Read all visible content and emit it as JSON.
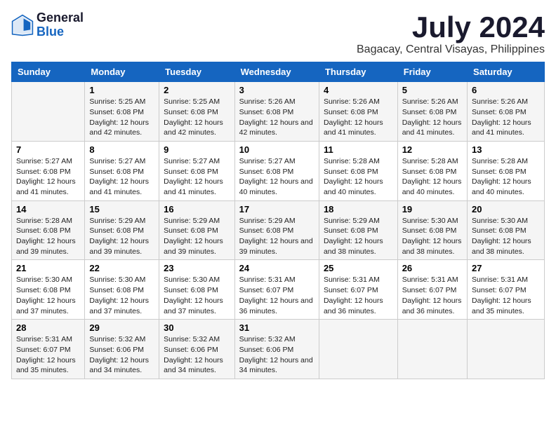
{
  "logo": {
    "general": "General",
    "blue": "Blue"
  },
  "title": "July 2024",
  "subtitle": "Bagacay, Central Visayas, Philippines",
  "days_header": [
    "Sunday",
    "Monday",
    "Tuesday",
    "Wednesday",
    "Thursday",
    "Friday",
    "Saturday"
  ],
  "weeks": [
    [
      {
        "day": "",
        "sunrise": "",
        "sunset": "",
        "daylight": ""
      },
      {
        "day": "1",
        "sunrise": "Sunrise: 5:25 AM",
        "sunset": "Sunset: 6:08 PM",
        "daylight": "Daylight: 12 hours and 42 minutes."
      },
      {
        "day": "2",
        "sunrise": "Sunrise: 5:25 AM",
        "sunset": "Sunset: 6:08 PM",
        "daylight": "Daylight: 12 hours and 42 minutes."
      },
      {
        "day": "3",
        "sunrise": "Sunrise: 5:26 AM",
        "sunset": "Sunset: 6:08 PM",
        "daylight": "Daylight: 12 hours and 42 minutes."
      },
      {
        "day": "4",
        "sunrise": "Sunrise: 5:26 AM",
        "sunset": "Sunset: 6:08 PM",
        "daylight": "Daylight: 12 hours and 41 minutes."
      },
      {
        "day": "5",
        "sunrise": "Sunrise: 5:26 AM",
        "sunset": "Sunset: 6:08 PM",
        "daylight": "Daylight: 12 hours and 41 minutes."
      },
      {
        "day": "6",
        "sunrise": "Sunrise: 5:26 AM",
        "sunset": "Sunset: 6:08 PM",
        "daylight": "Daylight: 12 hours and 41 minutes."
      }
    ],
    [
      {
        "day": "7",
        "sunrise": "Sunrise: 5:27 AM",
        "sunset": "Sunset: 6:08 PM",
        "daylight": "Daylight: 12 hours and 41 minutes."
      },
      {
        "day": "8",
        "sunrise": "Sunrise: 5:27 AM",
        "sunset": "Sunset: 6:08 PM",
        "daylight": "Daylight: 12 hours and 41 minutes."
      },
      {
        "day": "9",
        "sunrise": "Sunrise: 5:27 AM",
        "sunset": "Sunset: 6:08 PM",
        "daylight": "Daylight: 12 hours and 41 minutes."
      },
      {
        "day": "10",
        "sunrise": "Sunrise: 5:27 AM",
        "sunset": "Sunset: 6:08 PM",
        "daylight": "Daylight: 12 hours and 40 minutes."
      },
      {
        "day": "11",
        "sunrise": "Sunrise: 5:28 AM",
        "sunset": "Sunset: 6:08 PM",
        "daylight": "Daylight: 12 hours and 40 minutes."
      },
      {
        "day": "12",
        "sunrise": "Sunrise: 5:28 AM",
        "sunset": "Sunset: 6:08 PM",
        "daylight": "Daylight: 12 hours and 40 minutes."
      },
      {
        "day": "13",
        "sunrise": "Sunrise: 5:28 AM",
        "sunset": "Sunset: 6:08 PM",
        "daylight": "Daylight: 12 hours and 40 minutes."
      }
    ],
    [
      {
        "day": "14",
        "sunrise": "Sunrise: 5:28 AM",
        "sunset": "Sunset: 6:08 PM",
        "daylight": "Daylight: 12 hours and 39 minutes."
      },
      {
        "day": "15",
        "sunrise": "Sunrise: 5:29 AM",
        "sunset": "Sunset: 6:08 PM",
        "daylight": "Daylight: 12 hours and 39 minutes."
      },
      {
        "day": "16",
        "sunrise": "Sunrise: 5:29 AM",
        "sunset": "Sunset: 6:08 PM",
        "daylight": "Daylight: 12 hours and 39 minutes."
      },
      {
        "day": "17",
        "sunrise": "Sunrise: 5:29 AM",
        "sunset": "Sunset: 6:08 PM",
        "daylight": "Daylight: 12 hours and 39 minutes."
      },
      {
        "day": "18",
        "sunrise": "Sunrise: 5:29 AM",
        "sunset": "Sunset: 6:08 PM",
        "daylight": "Daylight: 12 hours and 38 minutes."
      },
      {
        "day": "19",
        "sunrise": "Sunrise: 5:30 AM",
        "sunset": "Sunset: 6:08 PM",
        "daylight": "Daylight: 12 hours and 38 minutes."
      },
      {
        "day": "20",
        "sunrise": "Sunrise: 5:30 AM",
        "sunset": "Sunset: 6:08 PM",
        "daylight": "Daylight: 12 hours and 38 minutes."
      }
    ],
    [
      {
        "day": "21",
        "sunrise": "Sunrise: 5:30 AM",
        "sunset": "Sunset: 6:08 PM",
        "daylight": "Daylight: 12 hours and 37 minutes."
      },
      {
        "day": "22",
        "sunrise": "Sunrise: 5:30 AM",
        "sunset": "Sunset: 6:08 PM",
        "daylight": "Daylight: 12 hours and 37 minutes."
      },
      {
        "day": "23",
        "sunrise": "Sunrise: 5:30 AM",
        "sunset": "Sunset: 6:08 PM",
        "daylight": "Daylight: 12 hours and 37 minutes."
      },
      {
        "day": "24",
        "sunrise": "Sunrise: 5:31 AM",
        "sunset": "Sunset: 6:07 PM",
        "daylight": "Daylight: 12 hours and 36 minutes."
      },
      {
        "day": "25",
        "sunrise": "Sunrise: 5:31 AM",
        "sunset": "Sunset: 6:07 PM",
        "daylight": "Daylight: 12 hours and 36 minutes."
      },
      {
        "day": "26",
        "sunrise": "Sunrise: 5:31 AM",
        "sunset": "Sunset: 6:07 PM",
        "daylight": "Daylight: 12 hours and 36 minutes."
      },
      {
        "day": "27",
        "sunrise": "Sunrise: 5:31 AM",
        "sunset": "Sunset: 6:07 PM",
        "daylight": "Daylight: 12 hours and 35 minutes."
      }
    ],
    [
      {
        "day": "28",
        "sunrise": "Sunrise: 5:31 AM",
        "sunset": "Sunset: 6:07 PM",
        "daylight": "Daylight: 12 hours and 35 minutes."
      },
      {
        "day": "29",
        "sunrise": "Sunrise: 5:32 AM",
        "sunset": "Sunset: 6:06 PM",
        "daylight": "Daylight: 12 hours and 34 minutes."
      },
      {
        "day": "30",
        "sunrise": "Sunrise: 5:32 AM",
        "sunset": "Sunset: 6:06 PM",
        "daylight": "Daylight: 12 hours and 34 minutes."
      },
      {
        "day": "31",
        "sunrise": "Sunrise: 5:32 AM",
        "sunset": "Sunset: 6:06 PM",
        "daylight": "Daylight: 12 hours and 34 minutes."
      },
      {
        "day": "",
        "sunrise": "",
        "sunset": "",
        "daylight": ""
      },
      {
        "day": "",
        "sunrise": "",
        "sunset": "",
        "daylight": ""
      },
      {
        "day": "",
        "sunrise": "",
        "sunset": "",
        "daylight": ""
      }
    ]
  ]
}
